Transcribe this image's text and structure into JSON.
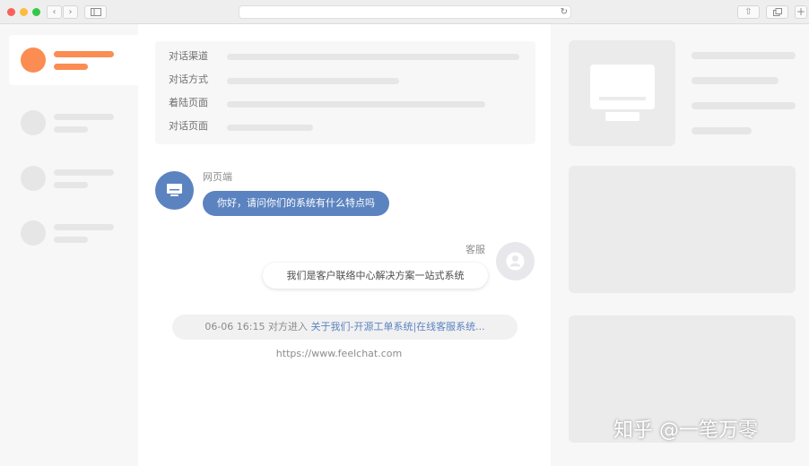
{
  "browser": {
    "icons": [
      "close-dot",
      "minimize-dot",
      "zoom-dot",
      "back-icon",
      "forward-icon",
      "sidebar-icon",
      "reload-icon",
      "share-icon",
      "tabs-icon",
      "new-tab-icon"
    ]
  },
  "info_panel": {
    "rows": [
      {
        "label": "对话渠道"
      },
      {
        "label": "对话方式"
      },
      {
        "label": "着陆页面"
      },
      {
        "label": "对话页面"
      }
    ]
  },
  "chat": {
    "visitor_name": "网页端",
    "visitor_message": "你好，请问你们的系统有什么特点吗",
    "agent_name": "客服",
    "agent_message": "我们是客户联络中心解决方案一站式系统",
    "notice_time": "06-06 16:15",
    "notice_text": "对方进入",
    "notice_link": "关于我们-开源工单系统|在线客服系统...",
    "site_url": "https://www.feelchat.com"
  },
  "watermark": "知乎 @一笔万零",
  "colors": {
    "accent_blue": "#5b83c0",
    "accent_orange": "#fb8d52",
    "placeholder_gray": "#e6e6e6"
  }
}
